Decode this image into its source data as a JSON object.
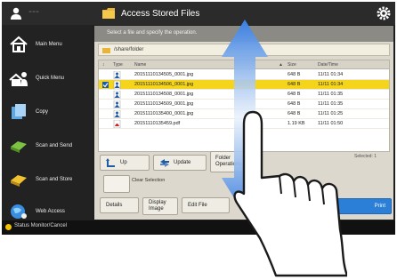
{
  "header": {
    "title": "Access Stored Files",
    "user_dash": "---"
  },
  "menu": {
    "items": [
      {
        "label": "Main Menu"
      },
      {
        "label": "Quick Menu"
      },
      {
        "label": "Copy"
      },
      {
        "label": "Scan and Send"
      },
      {
        "label": "Scan and Store"
      },
      {
        "label": "Web Access"
      }
    ]
  },
  "status": {
    "label": "Status Monitor/Cancel"
  },
  "main": {
    "instruction": "Select a file and specify the operation.",
    "path": "/share/folder",
    "columns": {
      "type": "Type",
      "name": "Name",
      "size": "Size",
      "date": "Date/Time"
    },
    "files": [
      {
        "name": "20151110134505_0001.jpg",
        "size": "648 B",
        "date": "11/11 01:34",
        "selected": false,
        "type": "image"
      },
      {
        "name": "20151110134506_0001.jpg",
        "size": "648 B",
        "date": "11/11 01:34",
        "selected": true,
        "type": "image"
      },
      {
        "name": "20151110134508_0001.jpg",
        "size": "648 B",
        "date": "11/11 01:35",
        "selected": false,
        "type": "image"
      },
      {
        "name": "20151110134509_0001.jpg",
        "size": "648 B",
        "date": "11/11 01:35",
        "selected": false,
        "type": "image"
      },
      {
        "name": "20151110135400_0001.jpg",
        "size": "648 B",
        "date": "11/11 01:25",
        "selected": false,
        "type": "image"
      },
      {
        "name": "20151110135459.pdf",
        "size": "1.19 KB",
        "date": "11/11 01:50",
        "selected": false,
        "type": "pdf"
      }
    ],
    "buttons": {
      "up": "Up",
      "update": "Update",
      "folder_ops": "Folder Operations",
      "clear_selection": "Clear Selection",
      "details": "Details",
      "display_image": "Display Image",
      "edit_file": "Edit File",
      "print": "Print"
    },
    "selected_col": "Selected: 1"
  },
  "colors": {
    "selection": "#f5d51b",
    "accent": "#2b7fd6",
    "arrow": "#3a7fe0"
  }
}
